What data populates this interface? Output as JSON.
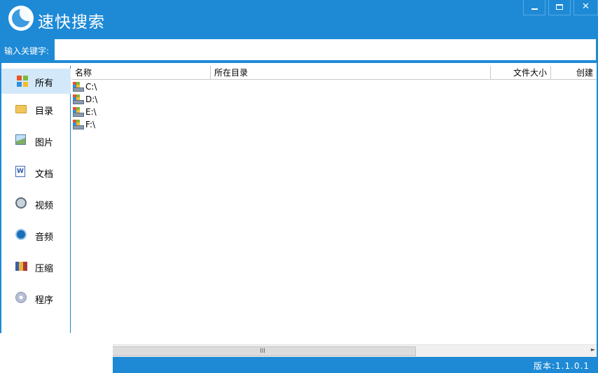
{
  "app": {
    "title": "速快搜索"
  },
  "window_controls": {
    "close_glyph": "✕"
  },
  "search": {
    "label": "输入关键字:",
    "value": "",
    "placeholder": ""
  },
  "sidebar": {
    "items": [
      {
        "label": "所有",
        "icon": "all-categories-icon",
        "active": true
      },
      {
        "label": "目录",
        "icon": "folder-icon",
        "active": false
      },
      {
        "label": "图片",
        "icon": "image-icon",
        "active": false
      },
      {
        "label": "文档",
        "icon": "document-icon",
        "active": false
      },
      {
        "label": "视频",
        "icon": "video-icon",
        "active": false
      },
      {
        "label": "音频",
        "icon": "audio-icon",
        "active": false
      },
      {
        "label": "压缩",
        "icon": "archive-icon",
        "active": false
      },
      {
        "label": "程序",
        "icon": "program-icon",
        "active": false
      }
    ]
  },
  "table": {
    "columns": [
      "名称",
      "所在目录",
      "文件大小",
      "创建"
    ],
    "rows": [
      {
        "name": "C:\\",
        "icon": "drive-icon"
      },
      {
        "name": "D:\\",
        "icon": "drive-icon"
      },
      {
        "name": "E:\\",
        "icon": "drive-icon"
      },
      {
        "name": "F:\\",
        "icon": "drive-icon"
      }
    ]
  },
  "scrollbar": {
    "grip": "III",
    "right_arrow": "►"
  },
  "status": {
    "version": "版本:1.1.0.1"
  },
  "colors": {
    "accent": "#1e8ad6",
    "sidebar_active": "#d3e9f9",
    "background": "#ffffff"
  }
}
